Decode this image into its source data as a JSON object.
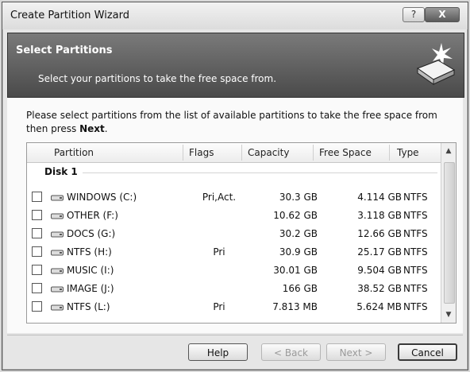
{
  "window": {
    "title": "Create Partition Wizard",
    "help_glyph": "?",
    "close_glyph": "X"
  },
  "banner": {
    "title": "Select Partitions",
    "subtitle": "Select your partitions to take the free space from."
  },
  "instructions": {
    "text": "Please select partitions from the list of available partitions to take the free space from then press ",
    "emphasis": "Next",
    "suffix": "."
  },
  "table": {
    "columns": [
      "Partition",
      "Flags",
      "Capacity",
      "Free Space",
      "Type"
    ],
    "group": "Disk 1",
    "rows": [
      {
        "checked": false,
        "name": "WINDOWS (C:)",
        "flags": "Pri,Act.",
        "capacity": "30.3 GB",
        "free": "4.114 GB",
        "type": "NTFS"
      },
      {
        "checked": false,
        "name": "OTHER (F:)",
        "flags": "",
        "capacity": "10.62 GB",
        "free": "3.118 GB",
        "type": "NTFS"
      },
      {
        "checked": false,
        "name": "DOCS (G:)",
        "flags": "",
        "capacity": "30.2 GB",
        "free": "12.66 GB",
        "type": "NTFS"
      },
      {
        "checked": false,
        "name": "NTFS (H:)",
        "flags": "Pri",
        "capacity": "30.9 GB",
        "free": "25.17 GB",
        "type": "NTFS"
      },
      {
        "checked": false,
        "name": "MUSIC (I:)",
        "flags": "",
        "capacity": "30.01 GB",
        "free": "9.504 GB",
        "type": "NTFS"
      },
      {
        "checked": false,
        "name": "IMAGE (J:)",
        "flags": "",
        "capacity": "166 GB",
        "free": "38.52 GB",
        "type": "NTFS"
      },
      {
        "checked": false,
        "name": "NTFS (L:)",
        "flags": "Pri",
        "capacity": "7.813 MB",
        "free": "5.624 MB",
        "type": "NTFS"
      }
    ]
  },
  "buttons": {
    "help": "Help",
    "back": "< Back",
    "next": "Next >",
    "cancel": "Cancel",
    "back_enabled": false,
    "next_enabled": false
  },
  "icons": {
    "banner": "disk-sparkle-icon",
    "partition": "drive-icon",
    "scroll_up": "chevron-up-icon",
    "scroll_down": "chevron-down-icon"
  }
}
